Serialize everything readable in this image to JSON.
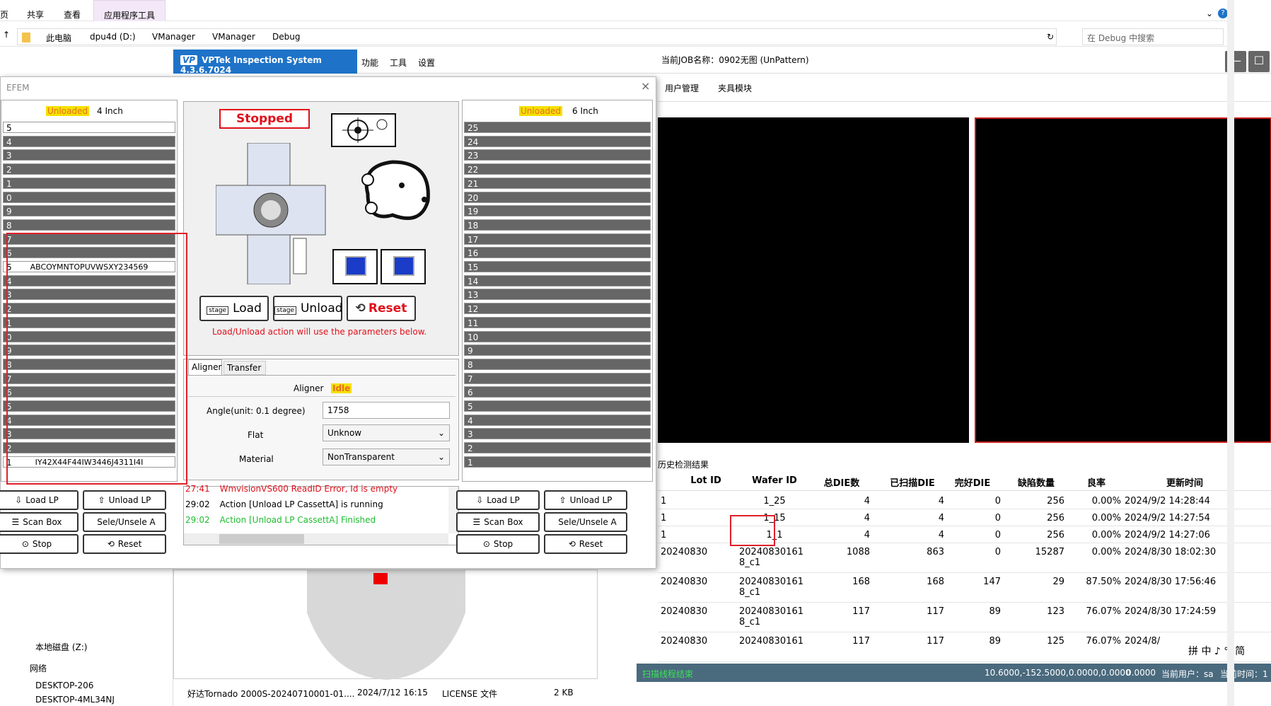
{
  "explorer": {
    "tabs": [
      "页",
      "共享",
      "查看",
      "应用程序工具"
    ],
    "breadcrumbs": [
      "此电脑",
      "dpu4d (D:)",
      "VManager",
      "VManager",
      "Debug"
    ],
    "search_placeholder": "在 Debug 中搜索",
    "nav_items": [
      "本地磁盘 (Z:)",
      "网络",
      "DESKTOP-206",
      "DESKTOP-4ML34NJ"
    ],
    "file_row": {
      "name": "好达Tornado 2000S-20240710001-01....",
      "date": "2024/7/12 16:15",
      "type": "LICENSE 文件",
      "size": "2 KB"
    }
  },
  "vptek": {
    "brand_logo": "VP",
    "title": "VPTek Inspection System 4.3.6.7024",
    "menu": [
      "功能",
      "工具",
      "设置"
    ],
    "job": "当前JOB名称：0902无图 (UnPattern)",
    "toolbar": [
      "用户管理",
      "夹具模块"
    ],
    "history_title": "历史检测结果",
    "history_headers": [
      "Lot ID",
      "Wafer ID",
      "总DIE数",
      "已扫描DIE",
      "完好DIE",
      "缺陷数量",
      "良率",
      "更新时间"
    ],
    "history_rows": [
      [
        "1",
        "1_25",
        "4",
        "4",
        "0",
        "256",
        "0.00%",
        "2024/9/2 14:28:44"
      ],
      [
        "1",
        "1_15",
        "4",
        "4",
        "0",
        "256",
        "0.00%",
        "2024/9/2 14:27:54"
      ],
      [
        "1",
        "1_1",
        "4",
        "4",
        "0",
        "256",
        "0.00%",
        "2024/9/2 14:27:06"
      ],
      [
        "20240830",
        "20240830161 8_c1",
        "1088",
        "863",
        "0",
        "15287",
        "0.00%",
        "2024/8/30 18:02:30"
      ],
      [
        "20240830",
        "20240830161 8_c1",
        "168",
        "168",
        "147",
        "29",
        "87.50%",
        "2024/8/30 17:56:46"
      ],
      [
        "20240830",
        "20240830161 8_c1",
        "117",
        "117",
        "89",
        "123",
        "76.07%",
        "2024/8/30 17:24:59"
      ],
      [
        "20240830",
        "20240830161",
        "117",
        "117",
        "89",
        "125",
        "76.07%",
        "2024/8/"
      ]
    ],
    "status": {
      "left": "扫描线程结束",
      "coords": "10.6000,-152.5000,0.0000,0.0000",
      "value": "0.0000",
      "user": "当前用户：sa",
      "time": "当前时间：1"
    },
    "ime": "拼 中 ♪ °, 简"
  },
  "efem": {
    "title": "EFEM",
    "left_lp": {
      "status": "Unloaded",
      "size": "4 Inch",
      "slots": [
        "5",
        "4",
        "3",
        "2",
        "1",
        "0",
        "9",
        "8",
        "7",
        "6",
        "5",
        "4",
        "3",
        "2",
        "1",
        "0",
        "9",
        "8",
        "7",
        "6",
        "5",
        "4",
        "3",
        "2",
        "1"
      ],
      "id_top": "ABCOYMNTOPUVWSXY234569",
      "id_bottom": "IY42X44F44IW3446J4311I4I",
      "buttons": [
        "Load LP",
        "Unload LP",
        "Scan Box",
        "Sele/Unsele A",
        "Stop",
        "Reset"
      ]
    },
    "right_lp": {
      "status": "Unloaded",
      "size": "6 Inch",
      "slots": [
        "25",
        "24",
        "23",
        "22",
        "21",
        "20",
        "19",
        "18",
        "17",
        "16",
        "15",
        "14",
        "13",
        "12",
        "11",
        "10",
        "9",
        "8",
        "7",
        "6",
        "5",
        "4",
        "3",
        "2",
        "1"
      ],
      "buttons": [
        "Load LP",
        "Unload LP",
        "Scan Box",
        "Sele/Unsele A",
        "Stop",
        "Reset"
      ]
    },
    "robot": {
      "state": "Stopped",
      "load": "Load",
      "unload": "Unload",
      "reset": "Reset",
      "stage": "stage",
      "hint": "Load/Unload action will use the parameters below."
    },
    "tabs": [
      "Aligner",
      "Transfer"
    ],
    "aligner": {
      "label": "Aligner",
      "state": "Idle",
      "angle_label": "Angle(unit:  0.1 degree)",
      "angle_value": "1758",
      "flat_label": "Flat",
      "flat_value": "Unknow",
      "material_label": "Material",
      "material_value": "NonTransparent"
    },
    "log": [
      {
        "time": "27:41",
        "msg": "WmvisionVS600 ReadID Error, Id is empty",
        "color": "red"
      },
      {
        "time": "29:02",
        "msg": "Action [Unload LP CassettA] is running",
        "color": "black"
      },
      {
        "time": "29:02",
        "msg": "Action [Unload LP CassettA] Finished",
        "color": "green"
      }
    ]
  },
  "colors": {
    "brand": "#1e73c8",
    "status_bar": "#4a6a7e",
    "alert_red": "#e0101a",
    "ok_green": "#1fbd30",
    "unloaded_bg": "#f5e000"
  }
}
